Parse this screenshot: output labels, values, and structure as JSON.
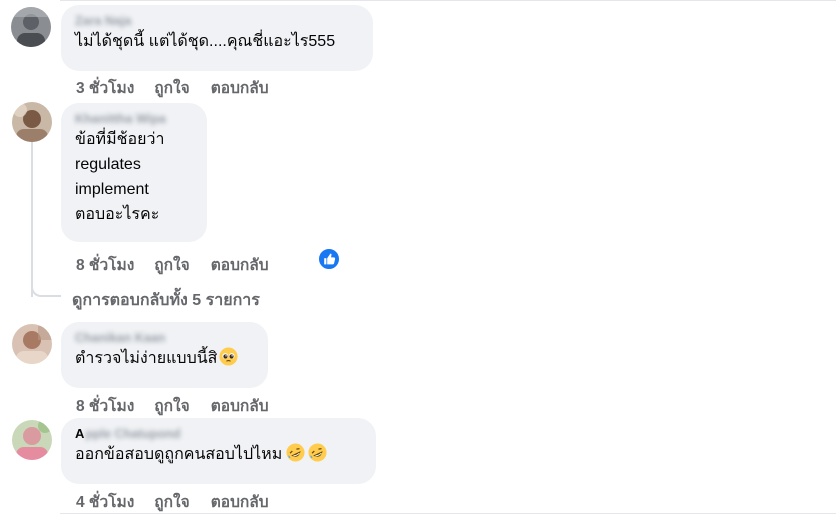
{
  "comments": [
    {
      "author": "Zara Naja",
      "lines": [
        "ไม่ได้ชุดนี้ แต่ได้ชุด....คุณชี่แอะไร555"
      ],
      "time": "3 ชั่วโมง",
      "like": "ถูกใจ",
      "reply": "ตอบกลับ"
    },
    {
      "author": "Khanittha Wipa",
      "lines": [
        "ข้อที่มีช้อยว่า",
        "regulates",
        "implement",
        "ตอบอะไรคะ"
      ],
      "time": "8 ชั่วโมง",
      "like": "ถูกใจ",
      "reply": "ตอบกลับ",
      "reaction_icon": "like-reaction-icon"
    },
    {
      "author": "Chanikan Kaan",
      "lines": [
        "ตำรวจไม่ง่ายแบบนี้สิ"
      ],
      "emoji": [
        "pleading-face-icon"
      ],
      "time": "8 ชั่วโมง",
      "like": "ถูกใจ",
      "reply": "ตอบกลับ"
    },
    {
      "author_initial": "A",
      "author": "pple Chatupond",
      "lines": [
        "ออกข้อสอบดูถูกคนสอบไปไหม"
      ],
      "emoji": [
        "rofl-icon",
        "rofl-icon"
      ],
      "time": "4 ชั่วโมง",
      "like": "ถูกใจ",
      "reply": "ตอบกลับ"
    }
  ],
  "view_replies": "ดูการตอบกลับทั้ง 5 รายการ",
  "colors": {
    "bubble": "#f0f2f5",
    "action_text": "#65676b",
    "like_blue": "#1877f2"
  }
}
